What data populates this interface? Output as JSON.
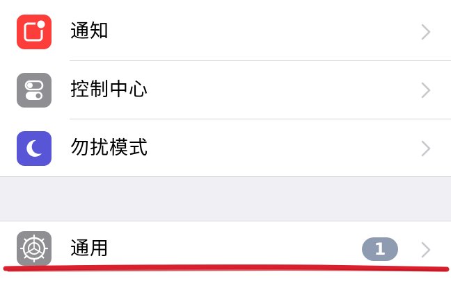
{
  "settings": {
    "rows": [
      {
        "label": "通知",
        "icon": "notifications-icon",
        "icon_color": "#fc3d39"
      },
      {
        "label": "控制中心",
        "icon": "control-center-icon",
        "icon_color": "#8e8e93"
      },
      {
        "label": "勿扰模式",
        "icon": "moon-icon",
        "icon_color": "#5856d6"
      },
      {
        "label": "通用",
        "icon": "gear-icon",
        "icon_color": "#8e8e93",
        "badge": "1"
      }
    ]
  },
  "colors": {
    "background": "#efeff4",
    "separator": "#d6d6da",
    "chevron": "#c7c7cc",
    "badge": "#8e9bb0",
    "annotation_red": "#d9202e"
  }
}
